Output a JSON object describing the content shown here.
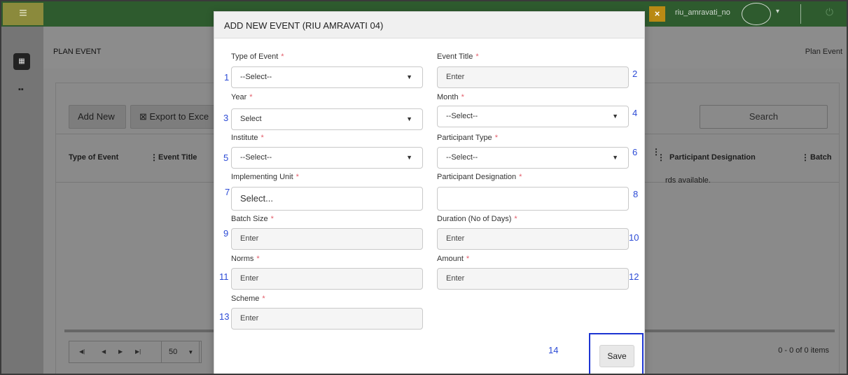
{
  "topbar": {
    "menu_icon": "hamburger-icon",
    "close_badge": "×",
    "user_name": "riu_amravati_no",
    "caret": "▾",
    "power_icon": "power-icon"
  },
  "page": {
    "title": "PLAN EVENT",
    "breadcrumb": "Plan Event"
  },
  "toolbar": {
    "add_new": "Add New",
    "export": "Export to Exce",
    "search_placeholder": "Search"
  },
  "grid": {
    "columns": [
      "Type of Event",
      "Event Title",
      "Participant Designation",
      "Batch"
    ],
    "empty_text": "rds available.",
    "page_size": "50",
    "items_count": "0 - 0 of 0 items"
  },
  "modal": {
    "title": "ADD NEW EVENT (RIU AMRAVATI 04)",
    "required_mark": "*",
    "fields": {
      "type_of_event": {
        "label": "Type of Event",
        "value": "--Select--",
        "number": "1"
      },
      "event_title": {
        "label": "Event Title",
        "placeholder": "Enter",
        "number": "2"
      },
      "year": {
        "label": "Year",
        "value": "Select",
        "number": "3"
      },
      "month": {
        "label": "Month",
        "value": "--Select--",
        "number": "4"
      },
      "institute": {
        "label": "Institute",
        "value": "--Select--",
        "number": "5"
      },
      "participant_type": {
        "label": "Participant Type",
        "value": "--Select--",
        "number": "6"
      },
      "implementing_unit": {
        "label": "Implementing Unit",
        "placeholder": "Select...",
        "number": "7"
      },
      "participant_designation": {
        "label": "Participant Designation",
        "placeholder": "",
        "number": "8"
      },
      "batch_size": {
        "label": "Batch Size",
        "placeholder": "Enter",
        "number": "9"
      },
      "duration": {
        "label": "Duration (No of Days)",
        "placeholder": "Enter",
        "number": "10"
      },
      "norms": {
        "label": "Norms",
        "placeholder": "Enter",
        "number": "11"
      },
      "amount": {
        "label": "Amount",
        "placeholder": "Enter",
        "number": "12"
      },
      "scheme": {
        "label": "Scheme",
        "placeholder": "Enter",
        "number": "13"
      }
    },
    "save_number": "14",
    "save_label": "Save"
  }
}
